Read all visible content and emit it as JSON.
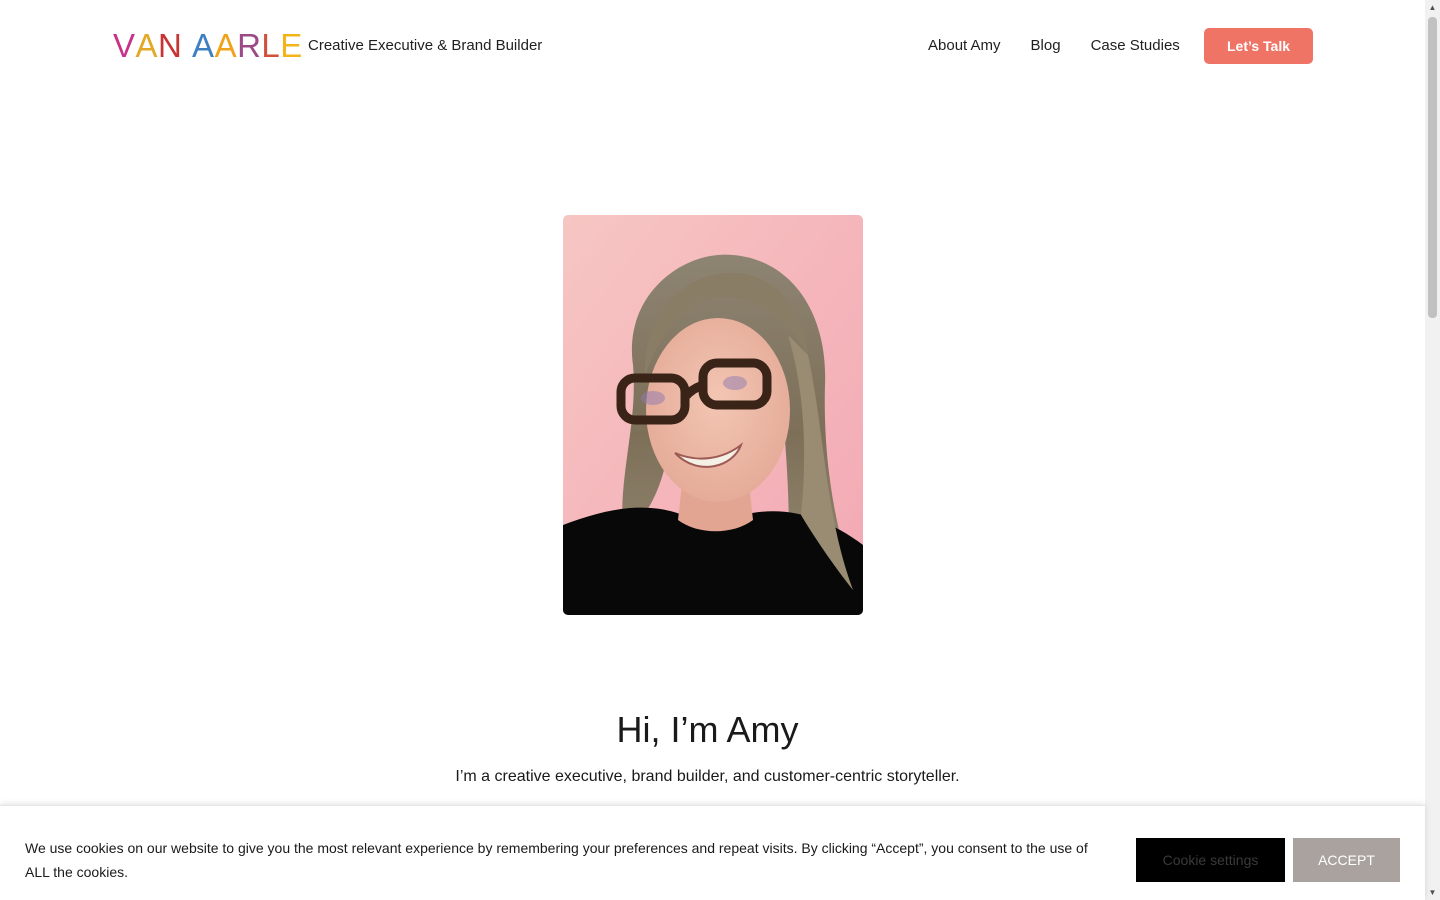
{
  "header": {
    "logo_letters": [
      {
        "char": "V",
        "color": "#c8338a"
      },
      {
        "char": "A",
        "color": "#e2a827"
      },
      {
        "char": "N",
        "color": "#c83434"
      },
      {
        "char": " ",
        "color": "#ffffff"
      },
      {
        "char": "A",
        "color": "#3d7fc1"
      },
      {
        "char": "A",
        "color": "#f0a21b"
      },
      {
        "char": "R",
        "color": "#9c4a86"
      },
      {
        "char": "L",
        "color": "#d24f3b"
      },
      {
        "char": "E",
        "color": "#f2b418"
      }
    ],
    "tagline": "Creative Executive & Brand Builder",
    "nav": {
      "about": "About Amy",
      "blog": "Blog",
      "case_studies": "Case Studies"
    },
    "cta_label": "Let’s Talk",
    "cta_color": "#ef7466"
  },
  "hero": {
    "title": "Hi, I’m Amy",
    "subtitle": "I’m a creative executive, brand builder, and customer-centric storyteller."
  },
  "cookie_banner": {
    "text": "We use cookies on our website to give you the most relevant experience by remembering your preferences and repeat visits. By clicking “Accept”, you consent to the use of ALL the cookies.",
    "settings_label": "Cookie settings",
    "accept_label": "ACCEPT",
    "accept_color": "#a9a29f"
  },
  "scrollbar": {
    "up_icon": "▲",
    "down_icon": "▼"
  }
}
